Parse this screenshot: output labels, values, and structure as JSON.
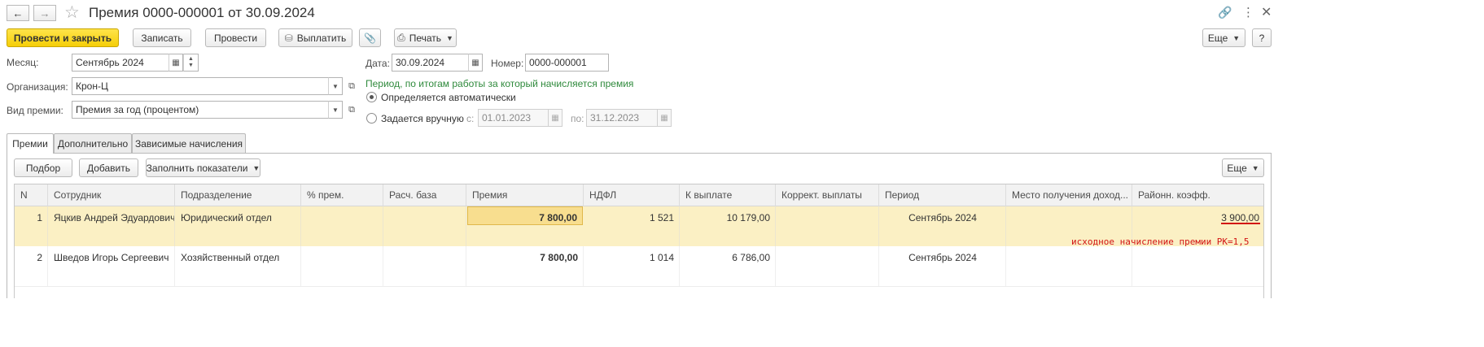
{
  "window": {
    "title": "Премия 0000-000001 от 30.09.2024"
  },
  "toolbar": {
    "post_and_close": "Провести и закрыть",
    "save": "Записать",
    "post": "Провести",
    "pay": "Выплатить",
    "print": "Печать",
    "more": "Еще",
    "help": "?"
  },
  "form": {
    "month_label": "Месяц:",
    "month_value": "Сентябрь 2024",
    "org_label": "Организация:",
    "org_value": "Крон-Ц",
    "bonus_type_label": "Вид премии:",
    "bonus_type_value": "Премия за год (процентом)",
    "date_label": "Дата:",
    "date_value": "30.09.2024",
    "number_label": "Номер:",
    "number_value": "0000-000001",
    "period_caption": "Период, по итогам работы за который начисляется премия",
    "period_auto": "Определяется автоматически",
    "period_manual": "Задается вручную",
    "from_label": "с:",
    "from_value": "01.01.2023",
    "to_label": "по:",
    "to_value": "31.12.2023"
  },
  "tabs": [
    "Премии",
    "Дополнительно",
    "Зависимые начисления"
  ],
  "table_toolbar": {
    "select": "Подбор",
    "add": "Добавить",
    "fill": "Заполнить показатели",
    "more": "Еще"
  },
  "table": {
    "columns": [
      "N",
      "Сотрудник",
      "Подразделение",
      "% прем.",
      "Расч. база",
      "Премия",
      "НДФЛ",
      "К выплате",
      "Коррект. выплаты",
      "Период",
      "Место получения доход...",
      "Районн. коэфф."
    ],
    "rows": [
      {
        "n": "1",
        "employee": "Яцкив Андрей Эдуардович",
        "department": "Юридический отдел",
        "percent": "",
        "base": "",
        "bonus": "7 800,00",
        "ndfl": "1 521",
        "payout": "10 179,00",
        "correction": "",
        "period": "Сентябрь 2024",
        "income_place": "",
        "regional_coef": "3 900,00"
      },
      {
        "n": "2",
        "employee": "Шведов Игорь Сергеевич",
        "department": "Хозяйственный отдел",
        "percent": "",
        "base": "",
        "bonus": "7 800,00",
        "ndfl": "1 014",
        "payout": "6 786,00",
        "correction": "",
        "period": "Сентябрь 2024",
        "income_place": "",
        "regional_coef": ""
      }
    ]
  },
  "annotation": {
    "text": "исходное начисление премии РК=1,5",
    "color": "#d21414"
  },
  "colors": {
    "primary_button": "#f5ce08",
    "selected_row": "#fbf0c4",
    "focused_cell": "#f8de8f",
    "period_caption": "#2f8a3c"
  },
  "icons": [
    "back-arrow-icon",
    "forward-arrow-icon",
    "star-icon",
    "link-icon",
    "kebab-menu-icon",
    "close-icon",
    "coins-icon",
    "paperclip-icon",
    "printer-icon",
    "calendar-icon",
    "dropdown-icon",
    "open-icon"
  ]
}
